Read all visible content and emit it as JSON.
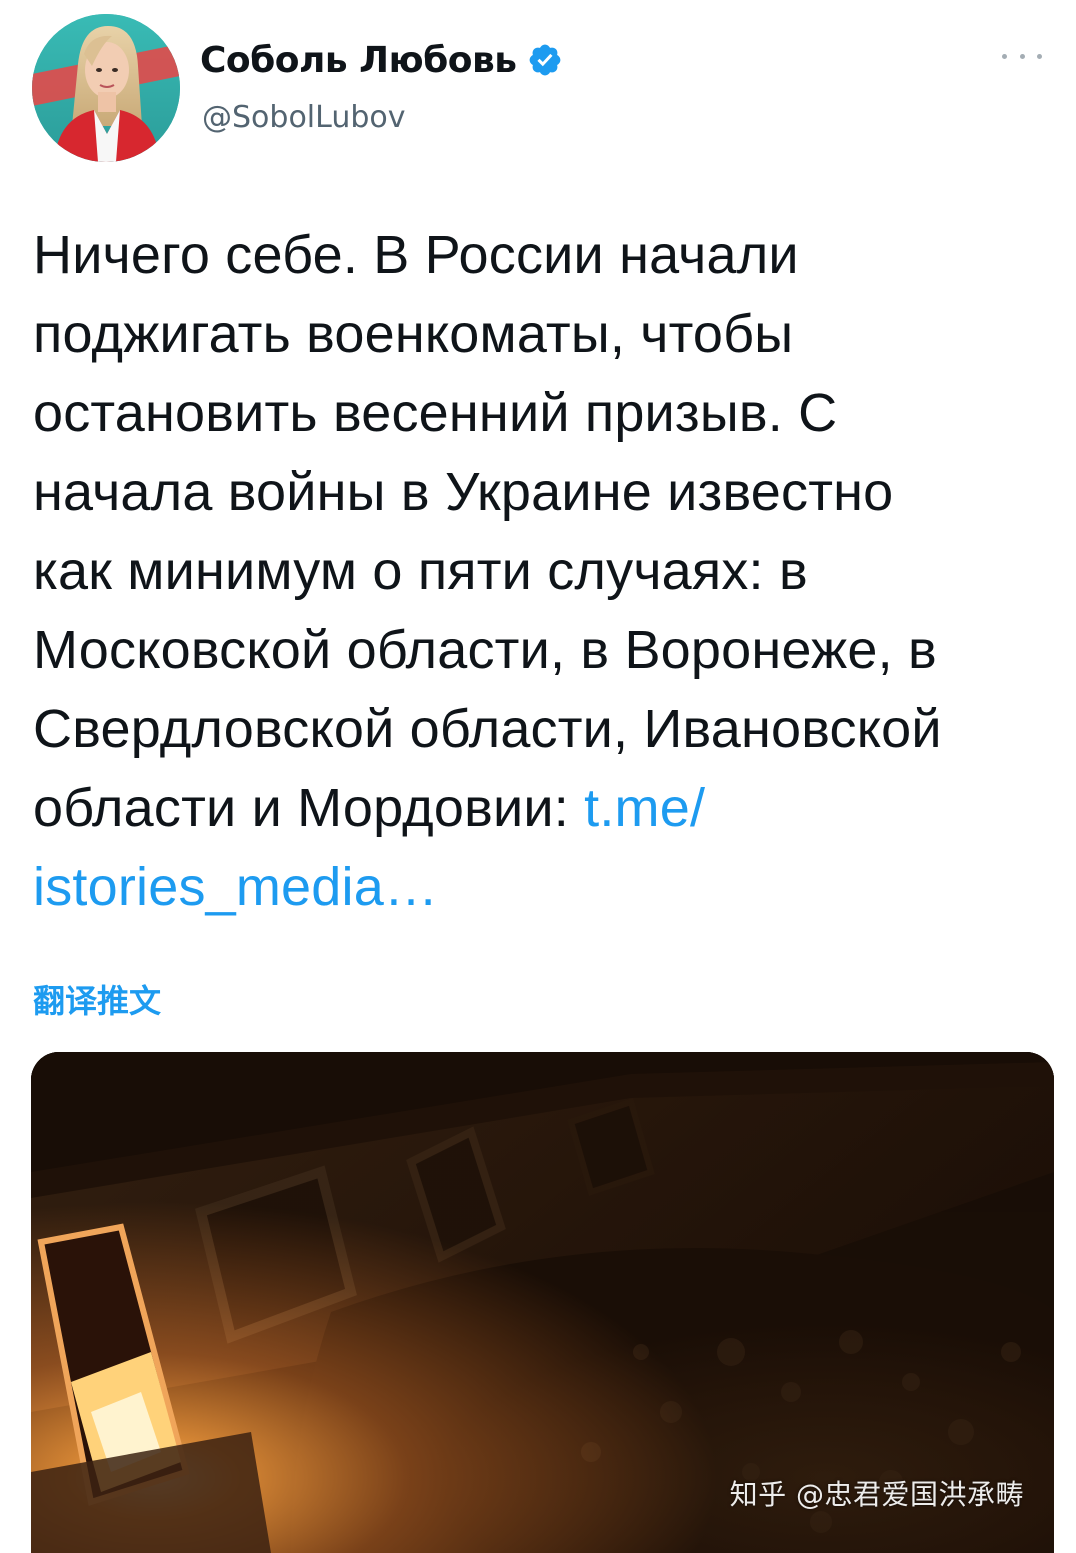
{
  "author": {
    "display_name": "Соболь Любовь",
    "handle": "@SobolLubov",
    "verified": true
  },
  "tweet": {
    "text": "Ничего себе. В России начали\nподжигать военкоматы, чтобы\nостановить весенний призыв. С\nначала войны в Украине известно\nкак минимум о пяти случаях: в\nМосковской области, в Воронеже, в\nСвердловской области, Ивановской\nобласти и Мордовии: ",
    "link_line1": "t.me/",
    "link_line2": "istories_media…",
    "translate_label": "翻译推文"
  },
  "media": {
    "watermark": "知乎 @忠君爱国洪承畴"
  },
  "colors": {
    "link": "#1d9bf0",
    "text": "#0f1419",
    "secondary": "#536471",
    "verified": "#1d9bf0"
  },
  "icons": {
    "verified": "verified-badge-icon",
    "more": "more-options-icon"
  }
}
